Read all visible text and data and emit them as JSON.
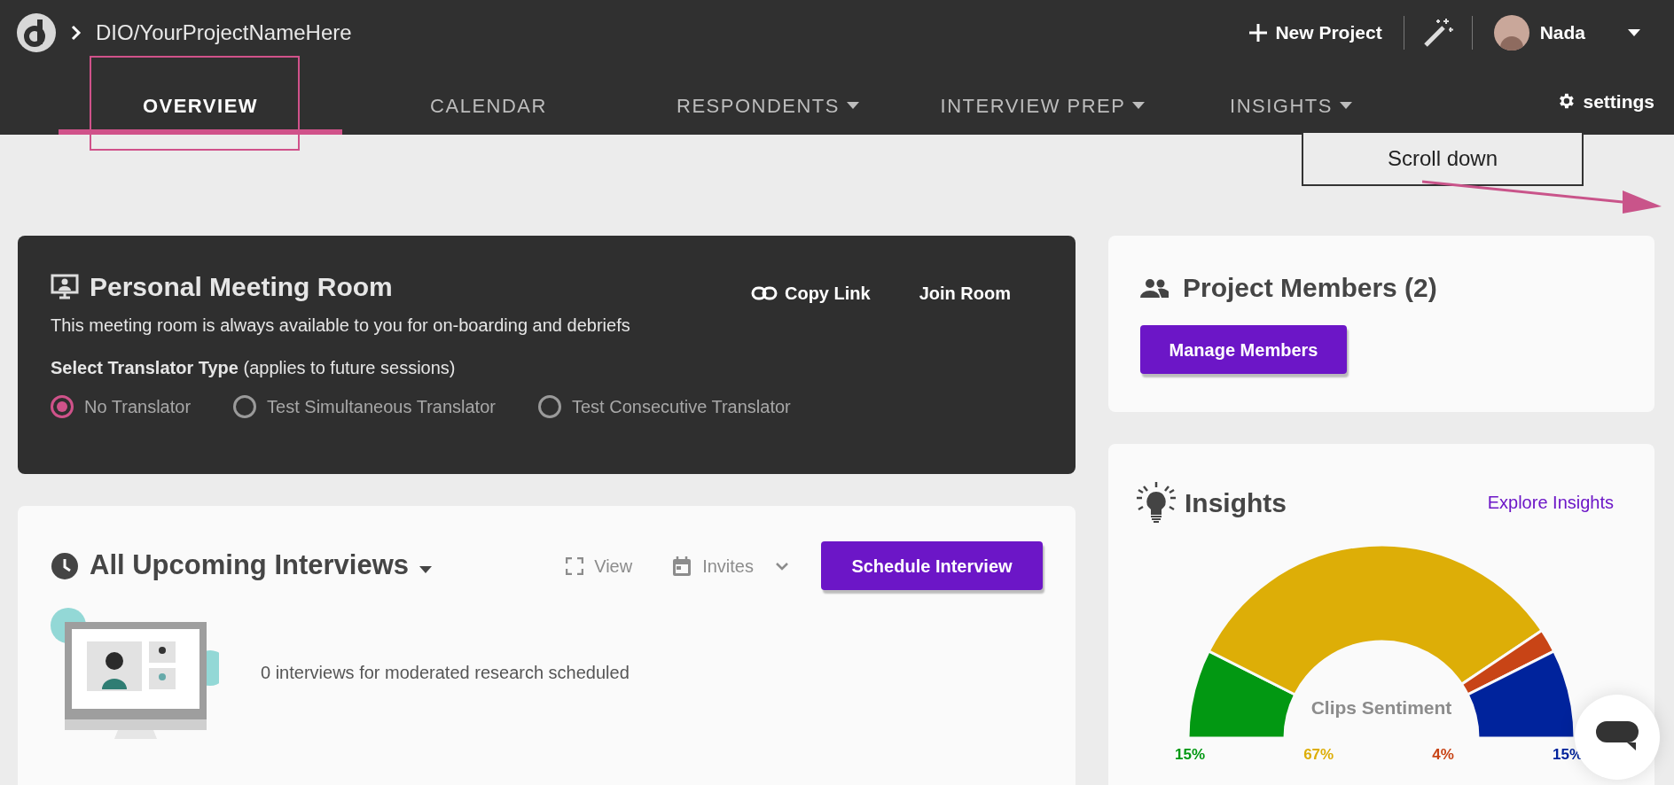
{
  "header": {
    "breadcrumb": "DIO/YourProjectNameHere",
    "new_project": "New Project",
    "user": "Nada"
  },
  "tabs": [
    {
      "label": "OVERVIEW",
      "selected": true,
      "dropdown": false
    },
    {
      "label": "CALENDAR",
      "selected": false,
      "dropdown": false
    },
    {
      "label": "RESPONDENTS",
      "selected": false,
      "dropdown": true
    },
    {
      "label": "INTERVIEW PREP",
      "selected": false,
      "dropdown": true
    },
    {
      "label": "INSIGHTS",
      "selected": false,
      "dropdown": true
    }
  ],
  "settings": "settings",
  "annotation": {
    "note": "Scroll down"
  },
  "meeting_room": {
    "title": "Personal Meeting Room",
    "copy_link": "Copy Link",
    "join_room": "Join Room",
    "description": "This meeting room is always available to you for on-boarding and debriefs",
    "translator_label": "**Select Translator Type** (applies to future sessions)",
    "translator_options": [
      {
        "label": "No Translator",
        "selected": true
      },
      {
        "label": "Test Simultaneous Translator",
        "selected": false
      },
      {
        "label": "Test Consecutive Translator",
        "selected": false
      }
    ]
  },
  "interviews": {
    "title": "All Upcoming Interviews",
    "view": "View",
    "invites": "Invites",
    "schedule": "Schedule Interview",
    "empty_message": "0 interviews for moderated research scheduled"
  },
  "members": {
    "title": "Project Members (2)",
    "manage": "Manage Members"
  },
  "insights": {
    "title": "Insights",
    "explore": "Explore Insights",
    "chart_data": {
      "type": "donut",
      "title": "Clips Sentiment",
      "values": [
        15,
        67,
        4,
        15
      ],
      "colors": [
        "#029812",
        "#ddae07",
        "#c84416",
        "#00239c"
      ],
      "value_labels": [
        "15%",
        "67%",
        "4%",
        "15%"
      ]
    }
  }
}
